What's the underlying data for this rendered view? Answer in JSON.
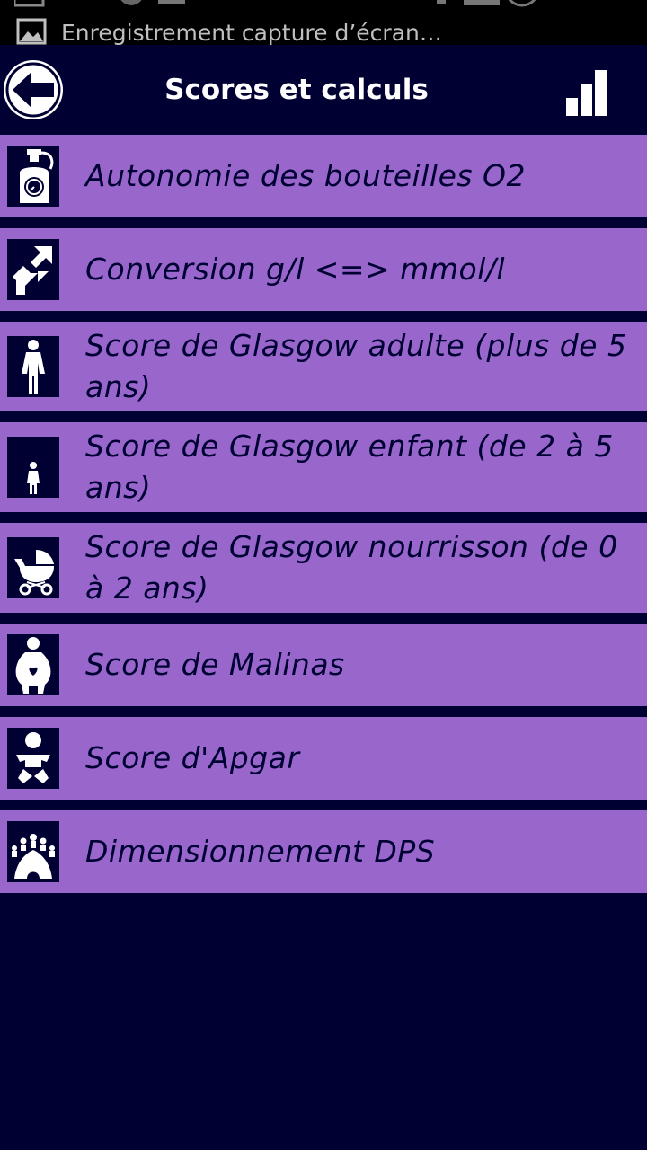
{
  "status_bar": {
    "notification_text": "Enregistrement capture d’écran…",
    "notification_icon": "image-icon"
  },
  "app_bar": {
    "title": "Scores et calculs",
    "back_icon": "back-arrow-icon",
    "stats_icon": "bar-chart-icon"
  },
  "colors": {
    "background": "#000033",
    "row_background": "#9966cc",
    "text_dark": "#000033",
    "text_light": "#ffffff"
  },
  "items": [
    {
      "label": "Autonomie des bouteilles O2",
      "icon": "oxygen-bottle-icon"
    },
    {
      "label": "Conversion g/l <=> mmol/l",
      "icon": "conversion-arrows-icon"
    },
    {
      "label": "Score de Glasgow adulte (plus de 5 ans)",
      "icon": "adult-person-icon"
    },
    {
      "label": "Score de Glasgow enfant (de 2 à 5 ans)",
      "icon": "child-person-icon"
    },
    {
      "label": "Score de Glasgow nourrisson (de 0 à 2 ans)",
      "icon": "baby-stroller-icon"
    },
    {
      "label": "Score de Malinas",
      "icon": "pregnant-woman-icon"
    },
    {
      "label": "Score d'Apgar",
      "icon": "newborn-baby-icon"
    },
    {
      "label": "Dimensionnement DPS",
      "icon": "crowd-tent-icon"
    }
  ]
}
